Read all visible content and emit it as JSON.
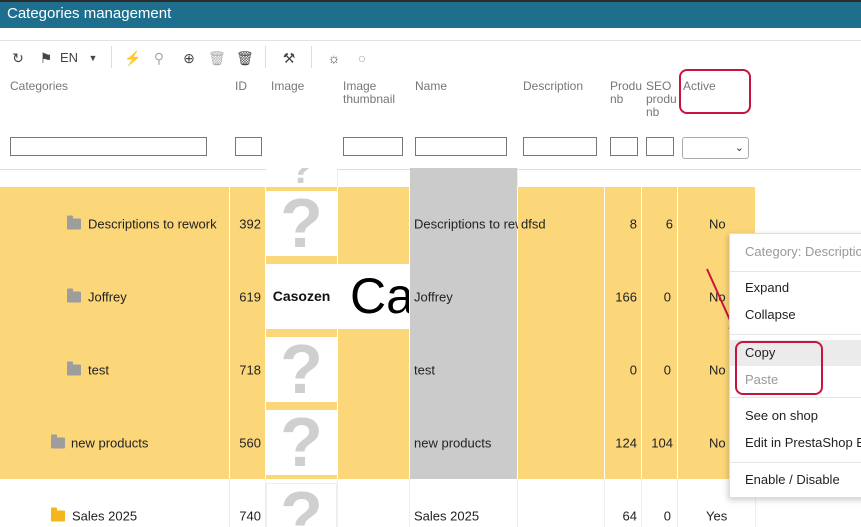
{
  "window": {
    "title": "Categories management"
  },
  "toolbar": {
    "language": "EN",
    "icons": [
      "refresh-icon",
      "flag-icon",
      "chevron-down-icon",
      "bolt-icon",
      "search-icon",
      "add-icon",
      "trash-icon",
      "trash-icon",
      "tools-icon",
      "bulb-on-icon",
      "bulb-off-icon"
    ]
  },
  "columns": {
    "categories": "Categories",
    "id": "ID",
    "image": "Image",
    "thumb1": "Image",
    "thumb2": "thumbnail",
    "name": "Name",
    "description": "Description",
    "products1": "Produ",
    "products2": "nb",
    "seo1": "SEO",
    "seo2": "produ",
    "seo3": "nb",
    "active": "Active"
  },
  "rows": [
    {
      "name": "Descriptions to rework",
      "id": "392",
      "image": "?",
      "name_col": "Descriptions to rew",
      "description": "dfsd",
      "products": "8",
      "seo": "6",
      "active": "No"
    },
    {
      "name": "Joffrey",
      "id": "619",
      "image": "Casozen",
      "thumb": "Ca",
      "name_col": "Joffrey",
      "description": "",
      "products": "166",
      "seo": "0",
      "active": "No"
    },
    {
      "name": "test",
      "id": "718",
      "image": "?",
      "name_col": "test",
      "description": "",
      "products": "0",
      "seo": "0",
      "active": "No"
    },
    {
      "name": "new products",
      "id": "560",
      "image": "?",
      "name_col": "new products",
      "description": "",
      "products": "124",
      "seo": "104",
      "active": "No"
    },
    {
      "name": "Sales 2025",
      "id": "740",
      "image": "?",
      "name_col": "Sales 2025",
      "description": "",
      "products": "64",
      "seo": "0",
      "active": "Yes"
    }
  ],
  "context_menu": {
    "header": "Category: Description",
    "expand": "Expand",
    "collapse": "Collapse",
    "copy": "Copy",
    "paste": "Paste",
    "see_on_shop": "See on shop",
    "edit_in_shop": "Edit in PrestaShop B",
    "enable_disable": "Enable / Disable"
  },
  "colors": {
    "titlebar": "#1d6f8d",
    "row_highlight": "#fcd77a",
    "annotation": "#c8143c"
  }
}
